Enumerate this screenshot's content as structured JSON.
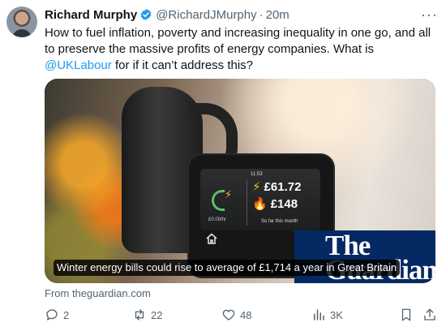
{
  "author": {
    "name": "Richard Murphy",
    "handle": "@RichardJMurphy",
    "separator": "·",
    "time": "20m",
    "verified": true
  },
  "tweet": {
    "text_before": "How to fuel inflation, poverty and increasing inequality in one go, and all to preserve the massive profits of energy companies. What is ",
    "mention": "@UKLabour",
    "text_after": " for if it can’t address this?"
  },
  "card": {
    "caption": "Winter energy bills could rise to average of £1,714 a year in Great Britain",
    "publisher_logo_line1": "The",
    "publisher_logo_line2": "Guardian",
    "source": "From theguardian.com",
    "device_screen": {
      "time": "11:53",
      "electricity_cost": "£61.72",
      "gas_cost": "£148",
      "rate": "£0.09/hr",
      "period": "So far this month"
    }
  },
  "actions": {
    "replies": "2",
    "reposts": "22",
    "likes": "48",
    "views": "3K"
  },
  "colors": {
    "link": "#1d9bf0",
    "verified": "#1d9bf0",
    "secondary_text": "#536471",
    "guardian_blue": "#052962"
  },
  "icons": [
    "verified-badge-icon",
    "more-icon",
    "reply-icon",
    "repost-icon",
    "like-icon",
    "views-icon",
    "bookmark-icon",
    "share-icon",
    "home-icon"
  ]
}
